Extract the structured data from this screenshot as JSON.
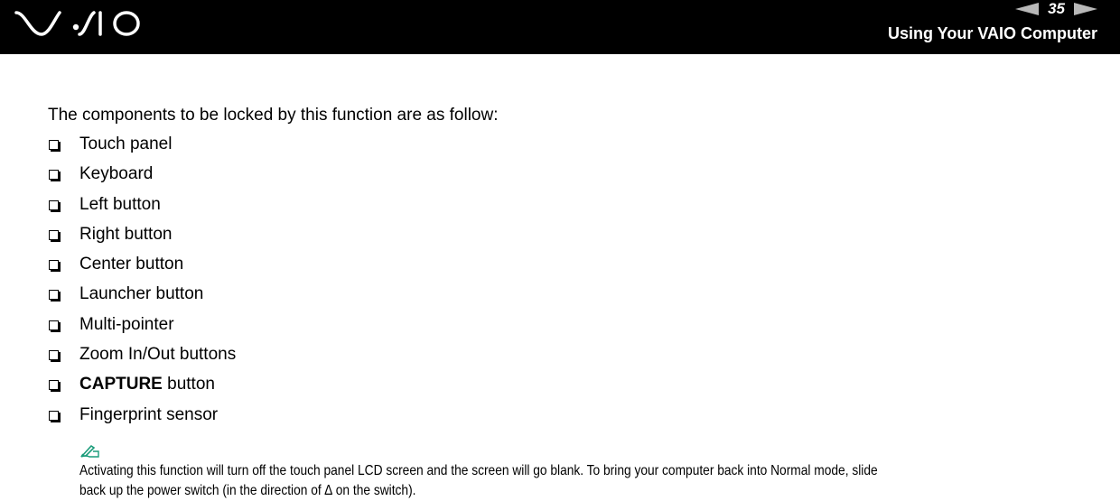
{
  "header": {
    "logo": "VAIO",
    "page_number": "35",
    "section_title": "Using Your VAIO Computer",
    "prev_icon": "arrow-left-icon",
    "next_icon": "arrow-right-icon"
  },
  "content": {
    "intro": "The components to be locked by this function are as follow:",
    "items": [
      {
        "bold": "",
        "text": "Touch panel"
      },
      {
        "bold": "",
        "text": "Keyboard"
      },
      {
        "bold": "",
        "text": "Left button"
      },
      {
        "bold": "",
        "text": "Right button"
      },
      {
        "bold": "",
        "text": "Center button"
      },
      {
        "bold": "",
        "text": "Launcher button"
      },
      {
        "bold": "",
        "text": "Multi-pointer"
      },
      {
        "bold": "",
        "text": "Zoom In/Out buttons"
      },
      {
        "bold": "CAPTURE",
        "text": " button"
      },
      {
        "bold": "",
        "text": "Fingerprint sensor"
      }
    ],
    "note": {
      "icon": "note-pencil-icon",
      "icon_color": "#1a9c7a",
      "line1": "Activating this function will turn off the touch panel LCD screen and the screen will go blank. To bring your computer back into Normal mode, slide",
      "line2": "back up the power switch (in the direction of ∆ on the switch)."
    }
  }
}
